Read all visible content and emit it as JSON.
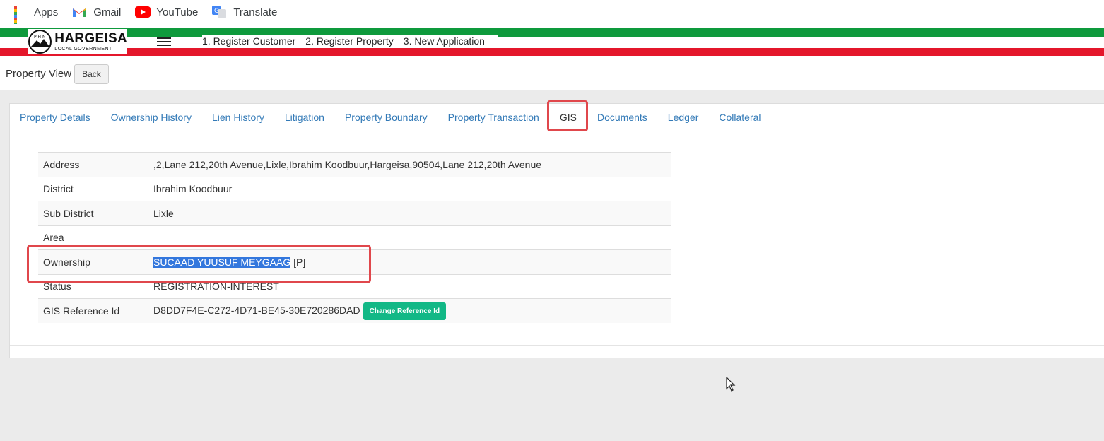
{
  "bookmarks": [
    {
      "label": "Apps",
      "icon": "apps-grid-icon"
    },
    {
      "label": "Gmail",
      "icon": "gmail-icon"
    },
    {
      "label": "YouTube",
      "icon": "youtube-icon"
    },
    {
      "label": "Translate",
      "icon": "translate-icon"
    }
  ],
  "logo": {
    "title": "HARGEISA",
    "subtitle": "LOCAL GOVERNMENT",
    "emblem_letters": "P H N"
  },
  "topnav": [
    "1. Register Customer",
    "2. Register Property",
    "3. New Application"
  ],
  "page": {
    "title": "Property View",
    "back_label": "Back"
  },
  "tabs": [
    {
      "label": "Property Details"
    },
    {
      "label": "Ownership History"
    },
    {
      "label": "Lien History"
    },
    {
      "label": "Litigation"
    },
    {
      "label": "Property Boundary"
    },
    {
      "label": "Property Transaction"
    },
    {
      "label": "GIS",
      "active": true
    },
    {
      "label": "Documents"
    },
    {
      "label": "Ledger"
    },
    {
      "label": "Collateral"
    }
  ],
  "details": {
    "address_label": "Address",
    "address_value": ",2,Lane 212,20th Avenue,Lixle,Ibrahim Koodbuur,Hargeisa,90504,Lane 212,20th Avenue",
    "district_label": "District",
    "district_value": "Ibrahim Koodbuur",
    "subdistrict_label": "Sub District",
    "subdistrict_value": "Lixle",
    "area_label": "Area",
    "area_value": "",
    "ownership_label": "Ownership",
    "ownership_name": "SUCAAD YUUSUF MEYGAAG",
    "ownership_suffix": " [P]",
    "status_label": "Status",
    "status_value": "REGISTRATION-INTEREST",
    "gis_label": "GIS Reference Id",
    "gis_value": "D8DD7F4E-C272-4D71-BE45-30E720286DAD",
    "change_ref_label": "Change Reference Id"
  },
  "colors": {
    "green_stripe": "#0e9a3c",
    "red_stripe": "#e4172b",
    "link": "#337ab7",
    "highlight_box": "#e0474c",
    "button_green": "#12b886",
    "selection": "#3377dd"
  }
}
